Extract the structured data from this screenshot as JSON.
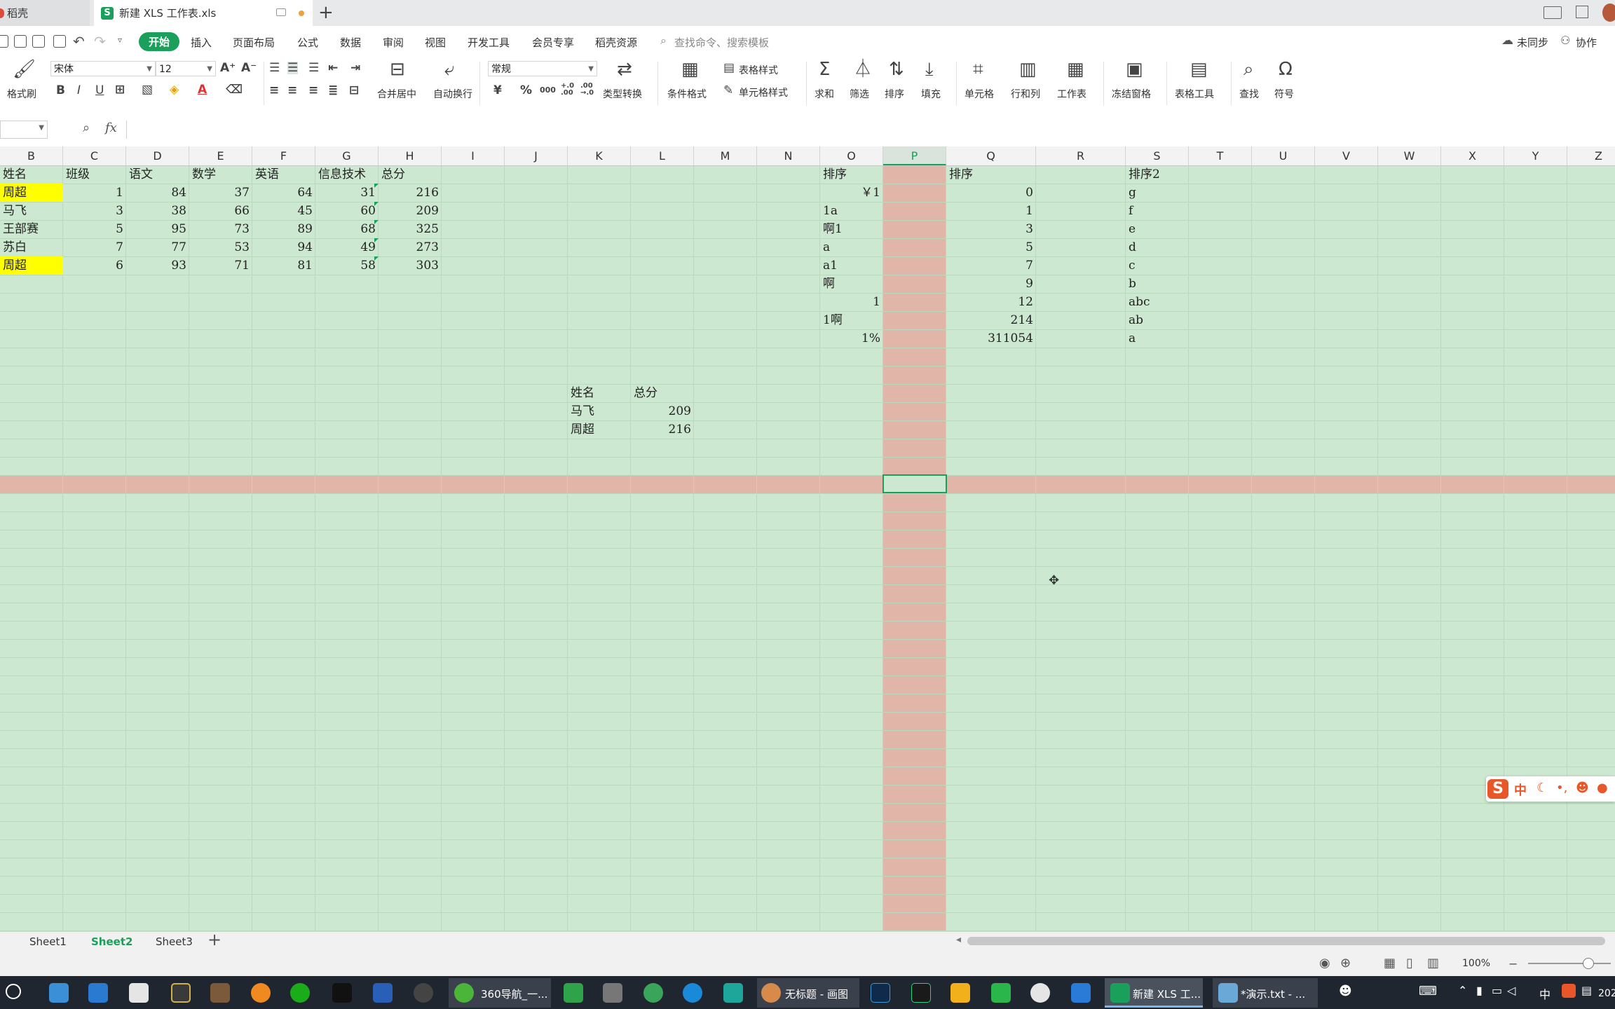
{
  "tabs": [
    {
      "label": "稻壳",
      "active": false
    },
    {
      "label": "新建 XLS 工作表.xls",
      "active": true,
      "icon": "S"
    }
  ],
  "new_tab": "+",
  "menu": [
    "开始",
    "插入",
    "页面布局",
    "公式",
    "数据",
    "审阅",
    "视图",
    "开发工具",
    "会员专享",
    "稻壳资源"
  ],
  "search_placeholder": "查找命令、搜索模板",
  "sync_label": "未同步",
  "collab_label": "协作",
  "ribbon": {
    "format_painter": "格式刷",
    "font_name": "宋体",
    "font_size": "12",
    "number_format": "常规",
    "merge_center": "合并居中",
    "wrap_text": "自动换行",
    "type_convert": "类型转换",
    "cond_format": "条件格式",
    "table_style": "表格样式",
    "cell_style": "单元格样式",
    "sum": "求和",
    "filter": "筛选",
    "sort": "排序",
    "fill": "填充",
    "cell": "单元格",
    "row_col": "行和列",
    "worksheet": "工作表",
    "freeze": "冻结窗格",
    "table_tools": "表格工具",
    "find": "查找",
    "symbol": "符号",
    "bold": "B",
    "italic": "I",
    "underline": "U",
    "font_color": "A",
    "currency": "¥",
    "percent": "%",
    "thousands": "000",
    "inc_decimal": "+.0 .00",
    "dec_decimal": ".00 →.0"
  },
  "formula": {
    "fx": "fx",
    "value": ""
  },
  "columns": [
    "B",
    "C",
    "D",
    "E",
    "F",
    "G",
    "H",
    "I",
    "J",
    "K",
    "L",
    "M",
    "N",
    "O",
    "P",
    "Q",
    "R",
    "S",
    "T",
    "U",
    "V",
    "W",
    "X",
    "Y",
    "Z"
  ],
  "selected_column": "P",
  "table1": {
    "headers": [
      "姓名",
      "班级",
      "语文",
      "数学",
      "英语",
      "信息技术",
      "总分"
    ],
    "rows": [
      [
        "周超",
        "1",
        "84",
        "37",
        "64",
        "31",
        "216"
      ],
      [
        "马飞",
        "3",
        "38",
        "66",
        "45",
        "60",
        "209"
      ],
      [
        "王部赛",
        "5",
        "95",
        "73",
        "89",
        "68",
        "325"
      ],
      [
        "苏白",
        "7",
        "77",
        "53",
        "94",
        "49",
        "273"
      ],
      [
        "周超",
        "6",
        "93",
        "71",
        "81",
        "58",
        "303"
      ]
    ],
    "highlighted_name_color": "#ffff00"
  },
  "sort_o": {
    "header": "排序",
    "values": [
      {
        "v": "￥1",
        "align": "right"
      },
      {
        "v": "1a",
        "align": "left"
      },
      {
        "v": "啊1",
        "align": "left"
      },
      {
        "v": "a",
        "align": "left"
      },
      {
        "v": "a1",
        "align": "left"
      },
      {
        "v": "啊",
        "align": "left"
      },
      {
        "v": "1",
        "align": "right"
      },
      {
        "v": "1啊",
        "align": "left"
      },
      {
        "v": "1%",
        "align": "right"
      }
    ]
  },
  "sort_q": {
    "header": "排序",
    "values": [
      "0",
      "1",
      "3",
      "5",
      "7",
      "9",
      "12",
      "214",
      "311054"
    ]
  },
  "sort_s": {
    "header": "排序2",
    "values": [
      "g",
      "f",
      "e",
      "d",
      "c",
      "b",
      "abc",
      "ab",
      "a"
    ]
  },
  "lookup": {
    "headers": [
      "姓名",
      "总分"
    ],
    "rows": [
      [
        "马飞",
        "209"
      ],
      [
        "周超",
        "216"
      ]
    ]
  },
  "sheets": [
    {
      "label": "Sheet1",
      "active": false
    },
    {
      "label": "Sheet2",
      "active": true
    },
    {
      "label": "Sheet3",
      "active": false
    }
  ],
  "add_sheet": "+",
  "zoom": "100%",
  "ime": {
    "label": "中"
  },
  "taskbar": [
    {
      "label": "360导航_一..."
    },
    {
      "label": "无标题 - 画图"
    },
    {
      "label": "新建 XLS 工..."
    },
    {
      "label": "*演示.txt - ..."
    }
  ],
  "tray": {
    "ime": "中",
    "clock": "202"
  },
  "colors": {
    "accent": "#1aa05a",
    "grid_bg": "#cde8d0",
    "selection": "#e2b5a9"
  }
}
